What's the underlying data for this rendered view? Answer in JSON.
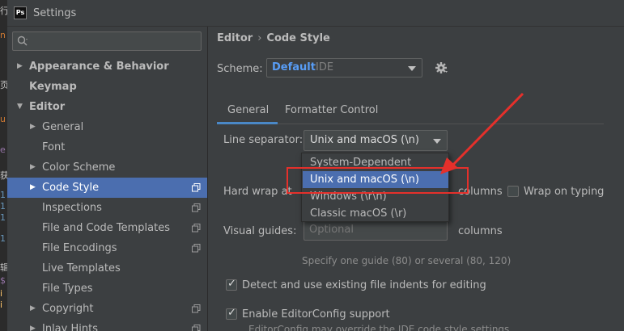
{
  "window": {
    "title": "Settings",
    "logo": "Ps"
  },
  "editor_edge": {
    "glyphs": [
      "行",
      "n",
      "页",
      "u",
      "e",
      "获",
      "1",
      "1",
      "1",
      "1",
      "辑",
      "$",
      "i",
      "i"
    ]
  },
  "search": {
    "placeholder": ""
  },
  "sidebar": {
    "items": [
      {
        "label": "Appearance & Behavior",
        "arrow": "▶",
        "bold": true
      },
      {
        "label": "Keymap",
        "bold": true
      },
      {
        "label": "Editor",
        "arrow": "▼",
        "bold": true
      },
      {
        "label": "General",
        "arrow": "▶"
      },
      {
        "label": "Font"
      },
      {
        "label": "Color Scheme",
        "arrow": "▶"
      },
      {
        "label": "Code Style",
        "arrow": "▶",
        "selected": true,
        "copy_icon": true
      },
      {
        "label": "Inspections",
        "copy_icon": true
      },
      {
        "label": "File and Code Templates",
        "copy_icon": true
      },
      {
        "label": "File Encodings",
        "copy_icon": true
      },
      {
        "label": "Live Templates"
      },
      {
        "label": "File Types"
      },
      {
        "label": "Copyright",
        "arrow": "▶",
        "copy_icon": true
      },
      {
        "label": "Inlay Hints",
        "arrow": "▶",
        "copy_icon": true
      }
    ]
  },
  "breadcrumb": {
    "parent": "Editor",
    "separator": "›",
    "current": "Code Style"
  },
  "scheme": {
    "label": "Scheme:",
    "name": "Default",
    "kind": "IDE"
  },
  "tabs": [
    {
      "label": "General",
      "active": true
    },
    {
      "label": "Formatter Control",
      "active": false
    }
  ],
  "form": {
    "line_separator": {
      "label": "Line separator:",
      "value": "Unix and macOS (\\n)",
      "options": [
        "System-Dependent",
        "Unix and macOS (\\n)",
        "Windows (\\r\\n)",
        "Classic macOS (\\r)"
      ],
      "highlighted_option": 1
    },
    "hard_wrap": {
      "label": "Hard wrap at",
      "unit": "columns",
      "wrap_on_typing_label": "Wrap on typing",
      "wrap_on_typing_checked": false
    },
    "visual_guides": {
      "label": "Visual guides:",
      "placeholder": "Optional",
      "unit": "columns",
      "hint": "Specify one guide (80) or several (80, 120)"
    },
    "detect_indents": {
      "label": "Detect and use existing file indents for editing",
      "checked": true
    },
    "editorconfig": {
      "label": "Enable EditorConfig support",
      "checked": true,
      "hint": "EditorConfig may override the IDE code style settings"
    }
  },
  "colors": {
    "selection": "#4b6eaf",
    "accent": "#589df6",
    "annotation": "#e5302b",
    "background": "#3c3f41"
  }
}
